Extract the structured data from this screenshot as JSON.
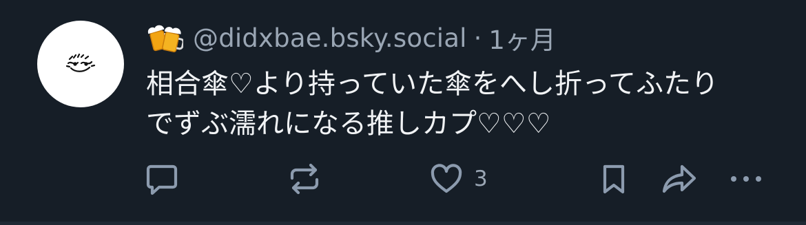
{
  "post": {
    "author_emoji": "beer-mugs-icon",
    "handle": "@didxbae.bsky.social",
    "separator": "·",
    "time": "1ヶ月",
    "text": "相合傘♡より持っていた傘をへし折ってふたり\nでずぶ濡れになる推しカプ♡♡♡"
  },
  "actions": {
    "reply_icon": "reply-icon",
    "repost_icon": "repost-icon",
    "like_icon": "heart-icon",
    "like_count": "3",
    "bookmark_icon": "bookmark-icon",
    "share_icon": "share-icon",
    "more_icon": "more-icon"
  },
  "colors": {
    "background": "#161e27",
    "text_primary": "#f1f3f5",
    "text_secondary": "#9aa6b4",
    "icon": "#8c9bae",
    "avatar_bg": "#ffffff"
  }
}
